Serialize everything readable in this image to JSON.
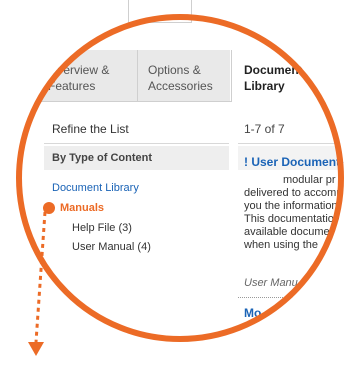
{
  "tabs": {
    "overview": {
      "line1": "Overview &",
      "line2": "Features"
    },
    "options": {
      "line1": "Options &",
      "line2": "Accessories"
    },
    "docs": {
      "line1": "Document",
      "line2": "Library"
    }
  },
  "sidebar": {
    "refine_title": "Refine the List",
    "by_type_title": "By Type of Content",
    "doc_library_link": "Document Library",
    "manuals_label": "Manuals",
    "help_file": "Help File (3)",
    "user_manual": "User Manual (4)"
  },
  "main": {
    "results_count": "1-7 of 7",
    "doc_title": "! User Documentation",
    "desc_lines": [
      "modular pr",
      "delivered to accomm",
      "you the information",
      "This documentation",
      "available docume",
      "when using the"
    ],
    "doc_type": "User Manu",
    "next_title": "Mo"
  },
  "colors": {
    "accent": "#ec6b26",
    "link": "#1a63b6",
    "tab_bg": "#e9e9e9"
  }
}
